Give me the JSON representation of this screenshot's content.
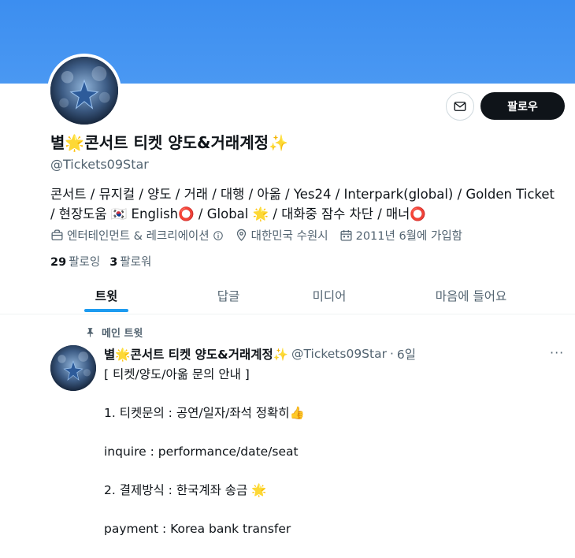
{
  "profile": {
    "display_name": "별🌟콘서트 티켓 양도&거래계정✨",
    "handle": "@Tickets09Star",
    "bio": "콘서트 / 뮤지컬 / 양도 / 거래 / 대행 / 아옮 / Yes24 / Interpark(global) / Golden Ticket / 현장도움 🇰🇷 English⭕ / Global 🌟 / 대화중 잠수 차단 / 매너⭕",
    "category": "엔터테인먼트 & 레크리에이션",
    "location": "대한민국 수원시",
    "joined": "2011년 6월에 가입함",
    "following_count": "29",
    "following_label": "팔로잉",
    "followers_count": "3",
    "followers_label": "팔로워",
    "follow_button": "팔로우"
  },
  "tabs": [
    {
      "label": "트윗",
      "active": true
    },
    {
      "label": "답글",
      "active": false
    },
    {
      "label": "미디어",
      "active": false
    },
    {
      "label": "마음에 들어요",
      "active": false
    }
  ],
  "pinned_tweet": {
    "pinned_label": "메인 트윗",
    "author_name": "별🌟콘서트 티켓 양도&거래계정✨",
    "author_handle": "@Tickets09Star",
    "separator": "·",
    "time": "6일",
    "more": "···",
    "lines": [
      "[ 티켓/양도/아옮 문의 안내 ]",
      "1. 티켓문의 : 공연/일자/좌석 정확히👍",
      "inquire : performance/date/seat",
      "2. 결제방식 : 한국계좌 송금 🌟",
      "payment : Korea bank transfer"
    ]
  },
  "colors": {
    "banner": "#4a98f2",
    "accent": "#1d9bf0",
    "text": "#0f1419",
    "muted": "#536471"
  },
  "icons": {
    "message": "envelope-icon",
    "category": "briefcase-icon",
    "location": "location-pin-icon",
    "joined": "calendar-icon",
    "pinned": "pin-icon",
    "info": "info-icon"
  }
}
